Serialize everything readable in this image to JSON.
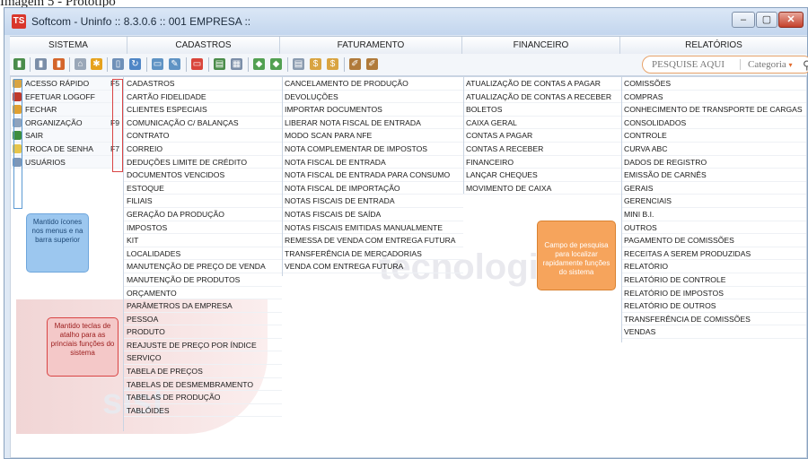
{
  "caption": "Imagem 5 - Protótipo",
  "window": {
    "title": "Softcom - Uninfo :: 8.3.0.6   :: 001 EMPRESA ::",
    "logo": "TS",
    "controls": [
      "minimize",
      "maximize",
      "close"
    ]
  },
  "menubar": [
    {
      "label": "SISTEMA"
    },
    {
      "label": "CADASTROS"
    },
    {
      "label": "FATURAMENTO"
    },
    {
      "label": "FINANCEIRO"
    },
    {
      "label": "RELATÓRIOS"
    }
  ],
  "search": {
    "placeholder": "PESQUISE AQUI",
    "category": "Categoria"
  },
  "sistema": {
    "items": [
      {
        "label": "ACESSO RÁPIDO",
        "key": "F5",
        "color": "#d9a441"
      },
      {
        "label": "EFETUAR LOGOFF",
        "key": "",
        "color": "#c0392b"
      },
      {
        "label": "FECHAR",
        "key": "",
        "color": "#e0a030"
      },
      {
        "label": "ORGANIZAÇÃO",
        "key": "F9",
        "color": "#8fa3bd"
      },
      {
        "label": "SAIR",
        "key": "",
        "color": "#3e8e3e"
      },
      {
        "label": "TROCA DE SENHA",
        "key": "F7",
        "color": "#e7c54a"
      },
      {
        "label": "USUÁRIOS",
        "key": "",
        "color": "#7d97b8"
      }
    ]
  },
  "cadastros": [
    "CADASTROS",
    "CARTÃO FIDELIDADE",
    "CLIENTES ESPECIAIS",
    "COMUNICAÇÃO C/ BALANÇAS",
    "CONTRATO",
    "CORREIO",
    "DEDUÇÕES LIMITE DE CRÉDITO",
    "DOCUMENTOS VENCIDOS",
    "ESTOQUE",
    "FILIAIS",
    "GERAÇÃO DA PRODUÇÃO",
    "IMPOSTOS",
    "KIT",
    "LOCALIDADES",
    "MANUTENÇÃO DE PREÇO DE VENDA",
    "MANUTENÇÃO DE PRODUTOS",
    "ORÇAMENTO",
    "PARÂMETROS DA EMPRESA",
    "PESSOA",
    "PRODUTO",
    "REAJUSTE DE PREÇO POR ÍNDICE",
    "SERVIÇO",
    "TABELA DE PREÇOS",
    "TABELAS DE DESMEMBRAMENTO",
    "TABELAS DE PRODUÇÃO",
    "TABLÓIDES"
  ],
  "faturamento": [
    "CANCELAMENTO DE PRODUÇÃO",
    "DEVOLUÇÕES",
    "IMPORTAR DOCUMENTOS",
    "LIBERAR NOTA FISCAL DE ENTRADA",
    "MODO SCAN PARA NFE",
    "NOTA COMPLEMENTAR DE IMPOSTOS",
    "NOTA FISCAL DE ENTRADA",
    "NOTA FISCAL DE ENTRADA PARA CONSUMO",
    "NOTA FISCAL DE IMPORTAÇÃO",
    "NOTAS FISCAIS DE ENTRADA",
    "NOTAS FISCAIS DE SAÍDA",
    "NOTAS FISCAIS EMITIDAS MANUALMENTE",
    "REMESSA DE VENDA COM ENTREGA FUTURA",
    "TRANSFERÊNCIA DE MERCADORIAS",
    "VENDA COM ENTREGA FUTURA"
  ],
  "financeiro": [
    "ATUALIZAÇÃO DE CONTAS A PAGAR",
    "ATUALIZAÇÃO DE CONTAS A RECEBER",
    "BOLETOS",
    "CAIXA GERAL",
    "CONTAS A PAGAR",
    "CONTAS A RECEBER",
    "FINANCEIRO",
    "LANÇAR CHEQUES",
    "MOVIMENTO DE CAIXA"
  ],
  "relatorios": [
    "COMISSÕES",
    "COMPRAS",
    "CONHECIMENTO DE TRANSPORTE DE CARGAS",
    "CONSOLIDADOS",
    "CONTROLE",
    "CURVA ABC",
    "DADOS DE REGISTRO",
    "EMISSÃO DE CARNÊS",
    "GERAIS",
    "GERENCIAIS",
    "MINI B.I.",
    "OUTROS",
    "PAGAMENTO DE COMISSÕES",
    "RECEITAS A SEREM PRODUZIDAS",
    "RELATÓRIO",
    "RELATÓRIO DE CONTROLE",
    "RELATÓRIO DE IMPOSTOS",
    "RELATÓRIO DE OUTROS",
    "TRANSFERÊNCIA DE COMISSÕES",
    "VENDAS"
  ],
  "callouts": {
    "blue": "Mantido ícones nos menus e na barra superior",
    "red": "Mantido teclas de atalho para as princiais funções do sistema",
    "orange": "Campo de pesquisa para localizar rapidamente funções do sistema"
  },
  "watermark": {
    "left": "sist",
    "right": "tecnologia"
  },
  "colors": {
    "blue_callout": "#9cc7ef",
    "red_callout": "#f4c8c8",
    "orange_callout": "#f6a45c"
  }
}
